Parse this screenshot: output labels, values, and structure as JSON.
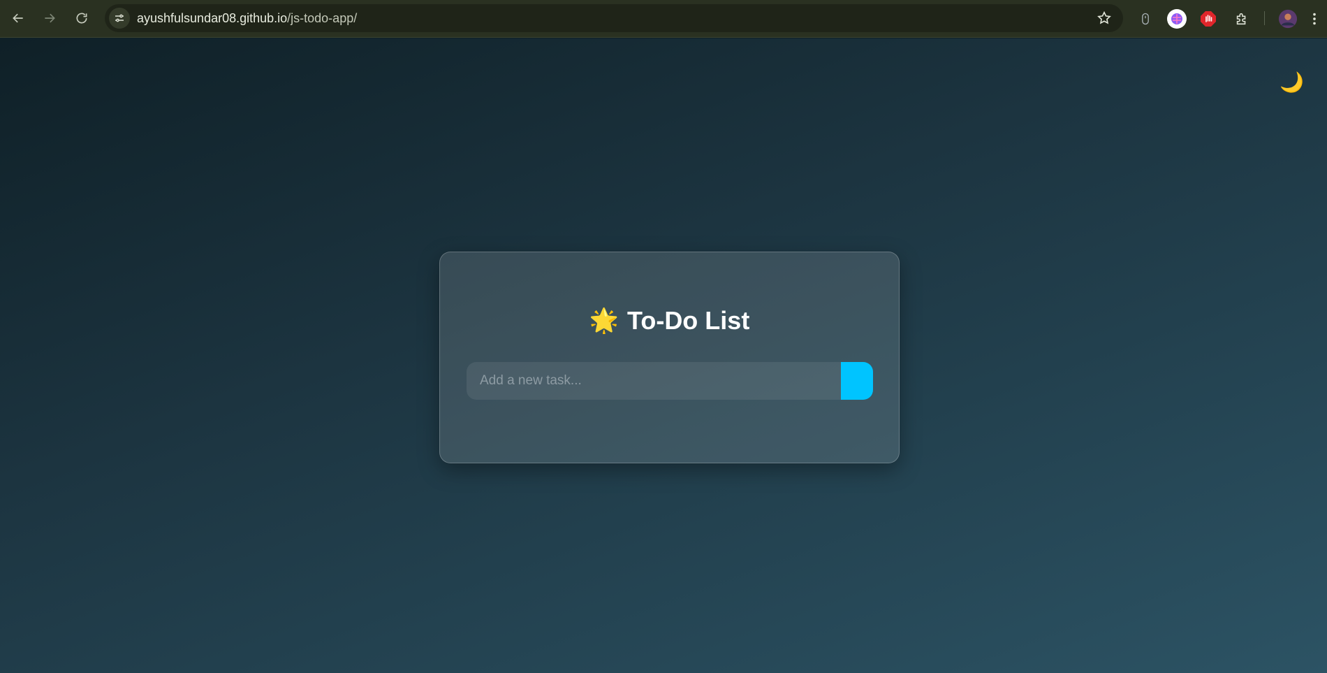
{
  "browser": {
    "url_host": "ayushfulsundar08.github.io",
    "url_path": "/js-todo-app/"
  },
  "app": {
    "theme_icon": "🌙",
    "title_emoji": "🌟",
    "title": "To-Do List",
    "input_placeholder": "Add a new task...",
    "input_value": "",
    "add_button_label": ""
  },
  "colors": {
    "accent": "#00c4ff",
    "bg_start": "#0f2027",
    "bg_end": "#2c5364"
  }
}
